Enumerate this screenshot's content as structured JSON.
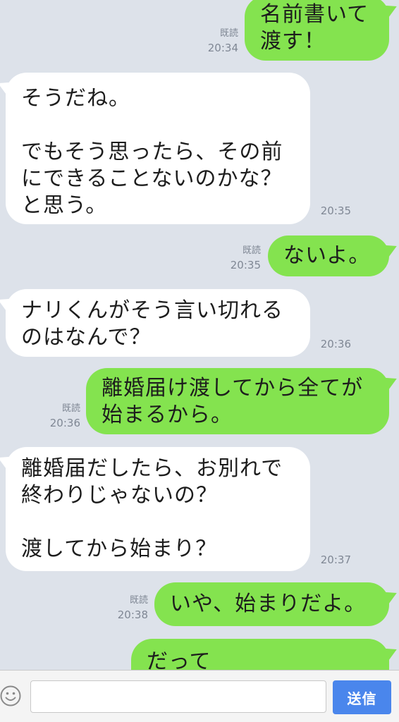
{
  "messages": [
    {
      "side": "out",
      "text": "名前書いて\n渡す！",
      "read": "既読",
      "time": "20:34"
    },
    {
      "side": "in",
      "text": "そうだね。\n\nでもそう思ったら、その前\nにできることないのかな？\nと思う。",
      "time": "20:35"
    },
    {
      "side": "out",
      "text": "ないよ。",
      "read": "既読",
      "time": "20:35"
    },
    {
      "side": "in",
      "text": "ナリくんがそう言い切れる\nのはなんで？",
      "time": "20:36"
    },
    {
      "side": "out",
      "text": "離婚届け渡してから全てが\n始まるから。",
      "read": "既読",
      "time": "20:36"
    },
    {
      "side": "in",
      "text": "離婚届だしたら、お別れで\n終わりじゃないの？\n\n渡してから始まり？",
      "time": "20:37"
    },
    {
      "side": "out",
      "text": "いや、始まりだよ。",
      "read": "既読",
      "time": "20:38"
    },
    {
      "side": "out",
      "text": "だって"
    }
  ],
  "input": {
    "value": "",
    "placeholder": ""
  },
  "send_label": "送信",
  "icons": {
    "emoji": "smiley-icon"
  },
  "colors": {
    "background": "#dde2ea",
    "outgoing": "#84e34f",
    "incoming": "#ffffff",
    "send": "#4a86ec"
  }
}
